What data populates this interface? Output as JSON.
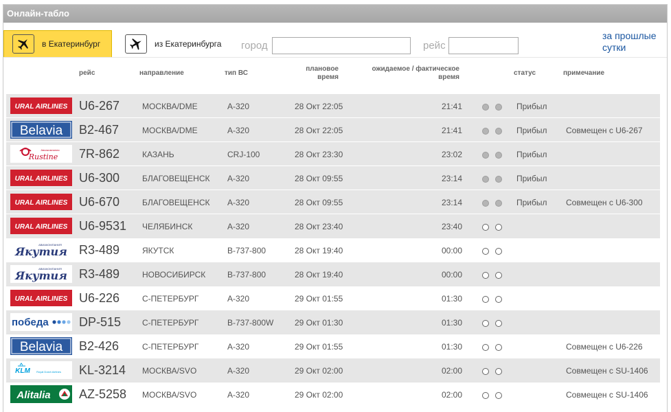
{
  "title": "Онлайн-табло",
  "tabs": [
    {
      "label": "в Екатеринбург",
      "icon": "plane-arrival-icon"
    },
    {
      "label": "из Екатеринбурга",
      "icon": "plane-departure-icon"
    }
  ],
  "filters": {
    "city_label": "город",
    "city_value": "",
    "flight_label": "рейс",
    "flight_value": ""
  },
  "past_link": "за прошлые сутки",
  "columns": {
    "flight": "рейс",
    "direction": "направление",
    "aircraft": "тип ВС",
    "planned": "плановое время",
    "actual": "ожидаемое / фактическое время",
    "status": "статус",
    "note": "примечание"
  },
  "colors": {
    "accent": "#ffd84a",
    "link": "#1a56a0",
    "row_shaded": "#e6e6e6"
  },
  "flights": [
    {
      "airline": "URAL AIRLINES",
      "logo": "ural",
      "flight": "U6-267",
      "direction": "МОСКВА/DME",
      "aircraft": "A-320",
      "planned": "28 Окт 22:05",
      "actual": "21:41",
      "arrived": true,
      "status": "Прибыл",
      "note": ""
    },
    {
      "airline": "Belavia",
      "logo": "belavia",
      "flight": "B2-467",
      "direction": "МОСКВА/DME",
      "aircraft": "A-320",
      "planned": "28 Окт 22:05",
      "actual": "21:41",
      "arrived": true,
      "status": "Прибыл",
      "note": "Совмещен с U6-267"
    },
    {
      "airline": "Rusline",
      "logo": "rusline",
      "flight": "7R-862",
      "direction": "КАЗАНЬ",
      "aircraft": "CRJ-100",
      "planned": "28 Окт 23:30",
      "actual": "23:02",
      "arrived": true,
      "status": "Прибыл",
      "note": ""
    },
    {
      "airline": "URAL AIRLINES",
      "logo": "ural",
      "flight": "U6-300",
      "direction": "БЛАГОВЕЩЕНСК",
      "aircraft": "A-320",
      "planned": "28 Окт 09:55",
      "actual": "23:14",
      "arrived": true,
      "status": "Прибыл",
      "note": ""
    },
    {
      "airline": "URAL AIRLINES",
      "logo": "ural",
      "flight": "U6-670",
      "direction": "БЛАГОВЕЩЕНСК",
      "aircraft": "A-320",
      "planned": "28 Окт 09:55",
      "actual": "23:14",
      "arrived": true,
      "status": "Прибыл",
      "note": "Совмещен с U6-300"
    },
    {
      "airline": "URAL AIRLINES",
      "logo": "ural",
      "flight": "U6-9531",
      "direction": "ЧЕЛЯБИНСК",
      "aircraft": "A-320",
      "planned": "28 Окт 23:40",
      "actual": "23:40",
      "arrived": false,
      "status": "",
      "note": ""
    },
    {
      "airline": "Якутия",
      "logo": "yakutia",
      "flight": "R3-489",
      "direction": "ЯКУТСК",
      "aircraft": "B-737-800",
      "planned": "28 Окт 19:40",
      "actual": "00:00",
      "arrived": false,
      "status": "",
      "note": ""
    },
    {
      "airline": "Якутия",
      "logo": "yakutia",
      "flight": "R3-489",
      "direction": "НОВОСИБИРСК",
      "aircraft": "B-737-800",
      "planned": "28 Окт 19:40",
      "actual": "00:00",
      "arrived": false,
      "status": "",
      "note": ""
    },
    {
      "airline": "URAL AIRLINES",
      "logo": "ural",
      "flight": "U6-226",
      "direction": "С-ПЕТЕРБУРГ",
      "aircraft": "A-320",
      "planned": "29 Окт 01:55",
      "actual": "01:30",
      "arrived": false,
      "status": "",
      "note": ""
    },
    {
      "airline": "победа",
      "logo": "pobeda",
      "flight": "DP-515",
      "direction": "С-ПЕТЕРБУРГ",
      "aircraft": "B-737-800W",
      "planned": "29 Окт 01:30",
      "actual": "01:30",
      "arrived": false,
      "status": "",
      "note": ""
    },
    {
      "airline": "Belavia",
      "logo": "belavia",
      "flight": "B2-426",
      "direction": "С-ПЕТЕРБУРГ",
      "aircraft": "A-320",
      "planned": "29 Окт 01:55",
      "actual": "01:30",
      "arrived": false,
      "status": "",
      "note": "Совмещен с U6-226"
    },
    {
      "airline": "KLM",
      "logo": "klm",
      "flight": "KL-3214",
      "direction": "МОСКВА/SVO",
      "aircraft": "A-320",
      "planned": "29 Окт 02:00",
      "actual": "02:00",
      "arrived": false,
      "status": "",
      "note": "Совмещен с SU-1406"
    },
    {
      "airline": "Alitalia",
      "logo": "alitalia",
      "flight": "AZ-5258",
      "direction": "МОСКВА/SVO",
      "aircraft": "A-320",
      "planned": "29 Окт 02:00",
      "actual": "02:00",
      "arrived": false,
      "status": "",
      "note": "Совмещен с SU-1406"
    }
  ]
}
